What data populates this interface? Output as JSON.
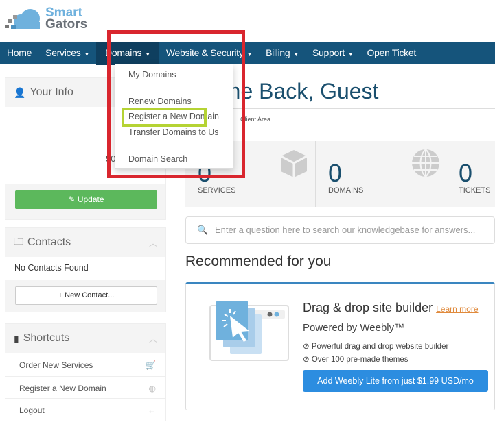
{
  "brand": {
    "line1": "Smart",
    "line2": "Gators"
  },
  "nav": [
    {
      "label": "Home"
    },
    {
      "label": "Services",
      "dropdown": true
    },
    {
      "label": "Domains",
      "dropdown": true,
      "active": true
    },
    {
      "label": "Website & Security",
      "dropdown": true
    },
    {
      "label": "Billing",
      "dropdown": true
    },
    {
      "label": "Support",
      "dropdown": true
    },
    {
      "label": "Open Ticket"
    }
  ],
  "domains_menu": {
    "items": [
      "My Domains",
      "Renew Domains",
      "Register a New Domain",
      "Transfer Domains to Us",
      "Domain Search"
    ],
    "highlighted": "Register a New Domain"
  },
  "sidebar": {
    "your_info": {
      "title": "Your Info",
      "partial_text": "50",
      "update": "Update"
    },
    "contacts": {
      "title": "Contacts",
      "empty": "No Contacts Found",
      "new": "New Contact..."
    },
    "shortcuts": {
      "title": "Shortcuts",
      "items": [
        {
          "label": "Order New Services",
          "icon": "cart-icon"
        },
        {
          "label": "Register a New Domain",
          "icon": "globe-icon"
        },
        {
          "label": "Logout",
          "icon": "arrow-left-icon"
        }
      ]
    }
  },
  "main": {
    "title": "Welcome Back, Guest",
    "title_visible": "come Back, Guest",
    "breadcrumb": "Client Area",
    "stats": [
      {
        "value": "0",
        "label": "SERVICES",
        "color": "#5bc0de"
      },
      {
        "value": "0",
        "label": "DOMAINS",
        "color": "#5cb85c"
      },
      {
        "value": "0",
        "label": "TICKETS",
        "color": "#d9534f"
      }
    ],
    "search_placeholder": "Enter a question here to search our knowledgebase for answers...",
    "recommended": "Recommended for you",
    "promo": {
      "title": "Drag & drop site builder",
      "learn": "Learn more",
      "subtitle": "Powered by Weebly™",
      "features": [
        "Powerful drag and drop website builder",
        "Over 100 pre-made themes"
      ],
      "button": "Add Weebly Lite from just $1.99 USD/mo"
    }
  },
  "colors": {
    "nav": "#15547b",
    "highlight_red": "#d9262e",
    "highlight_green": "#b5d334"
  }
}
